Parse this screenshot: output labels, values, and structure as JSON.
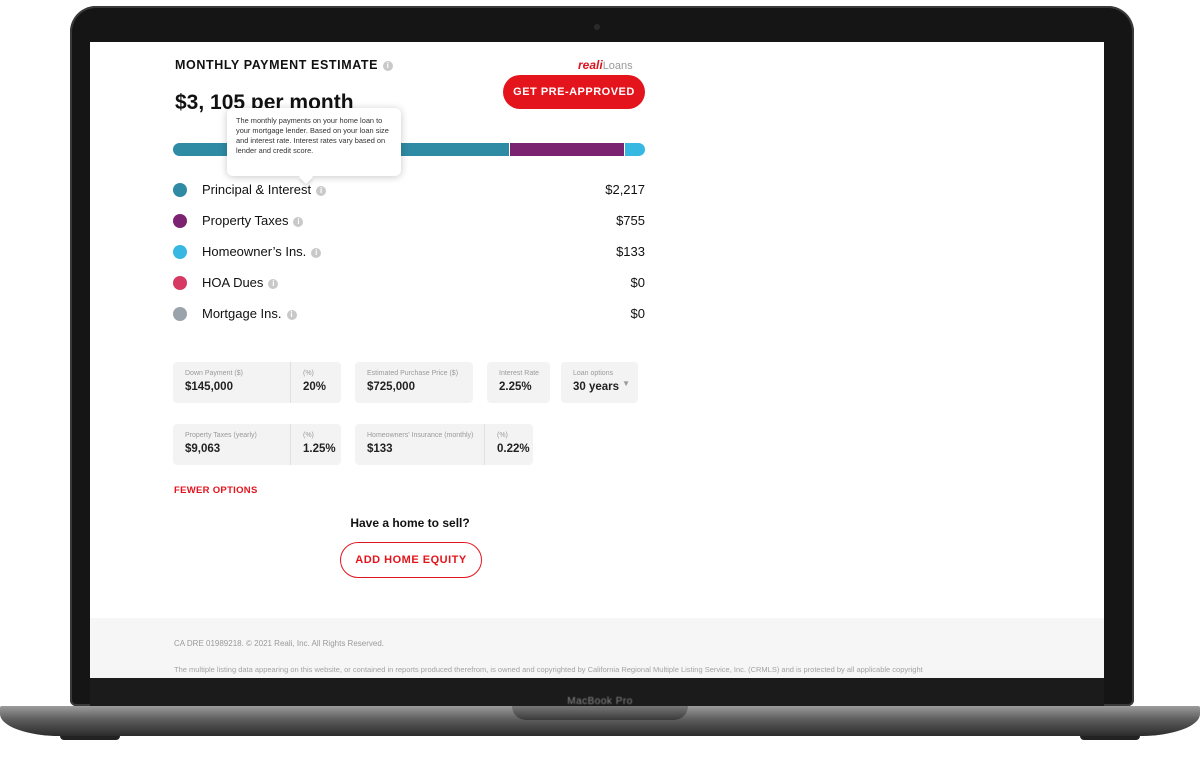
{
  "device": {
    "label": "MacBook Pro"
  },
  "header": {
    "title": "MONTHLY PAYMENT ESTIMATE",
    "logo_bold": "reali",
    "logo_light": "Loans",
    "cta": "GET PRE-APPROVED"
  },
  "summary": {
    "total": "$3, 105 per month"
  },
  "tooltip": {
    "text": "The monthly payments on your home loan to your mortgage lender. Based on your loan size and interest rate. Interest rates vary based on lender and credit score."
  },
  "colors": {
    "principal": "#2f8aa3",
    "taxes": "#7b2370",
    "insurance": "#36b8e3",
    "hoa": "#d63a63",
    "mortgage_ins": "#9aa3ab",
    "brand_red": "#e4141d"
  },
  "breakdown": [
    {
      "label": "Principal & Interest",
      "value": "$2,217",
      "amount": 2217
    },
    {
      "label": "Property Taxes",
      "value": "$755",
      "amount": 755
    },
    {
      "label": "Homeowner’s Ins.",
      "value": "$133",
      "amount": 133
    },
    {
      "label": "HOA Dues",
      "value": "$0",
      "amount": 0
    },
    {
      "label": "Mortgage Ins.",
      "value": "$0",
      "amount": 0
    }
  ],
  "fields": {
    "down_payment": {
      "label": "Down Payment ($)",
      "value": "$145,000"
    },
    "down_pct": {
      "label": "(%)",
      "value": "20%"
    },
    "purchase_price": {
      "label": "Estimated Purchase Price ($)",
      "value": "$725,000"
    },
    "interest_rate": {
      "label": "Interest Rate",
      "value": "2.25%"
    },
    "loan_options": {
      "label": "Loan options",
      "value": "30 years"
    },
    "property_taxes": {
      "label": "Property Taxes (yearly)",
      "value": "$9,063"
    },
    "tax_pct": {
      "label": "(%)",
      "value": "1.25%"
    },
    "home_insurance": {
      "label": "Homeowners' Insurance (monthly)",
      "value": "$133"
    },
    "ins_pct": {
      "label": "(%)",
      "value": "0.22%"
    }
  },
  "actions": {
    "fewer_options": "FEWER OPTIONS",
    "sell_question": "Have a home to sell?",
    "add_equity": "ADD HOME EQUITY"
  },
  "footer": {
    "copyright": "CA DRE 01989218. © 2021 Reali, Inc. All Rights Reserved.",
    "legal": "The multiple listing data appearing on this website, or contained in reports produced therefrom, is owned and copyrighted by California Regional Multiple Listing Service, Inc. (CRMLS) and is protected by all applicable copyright"
  }
}
